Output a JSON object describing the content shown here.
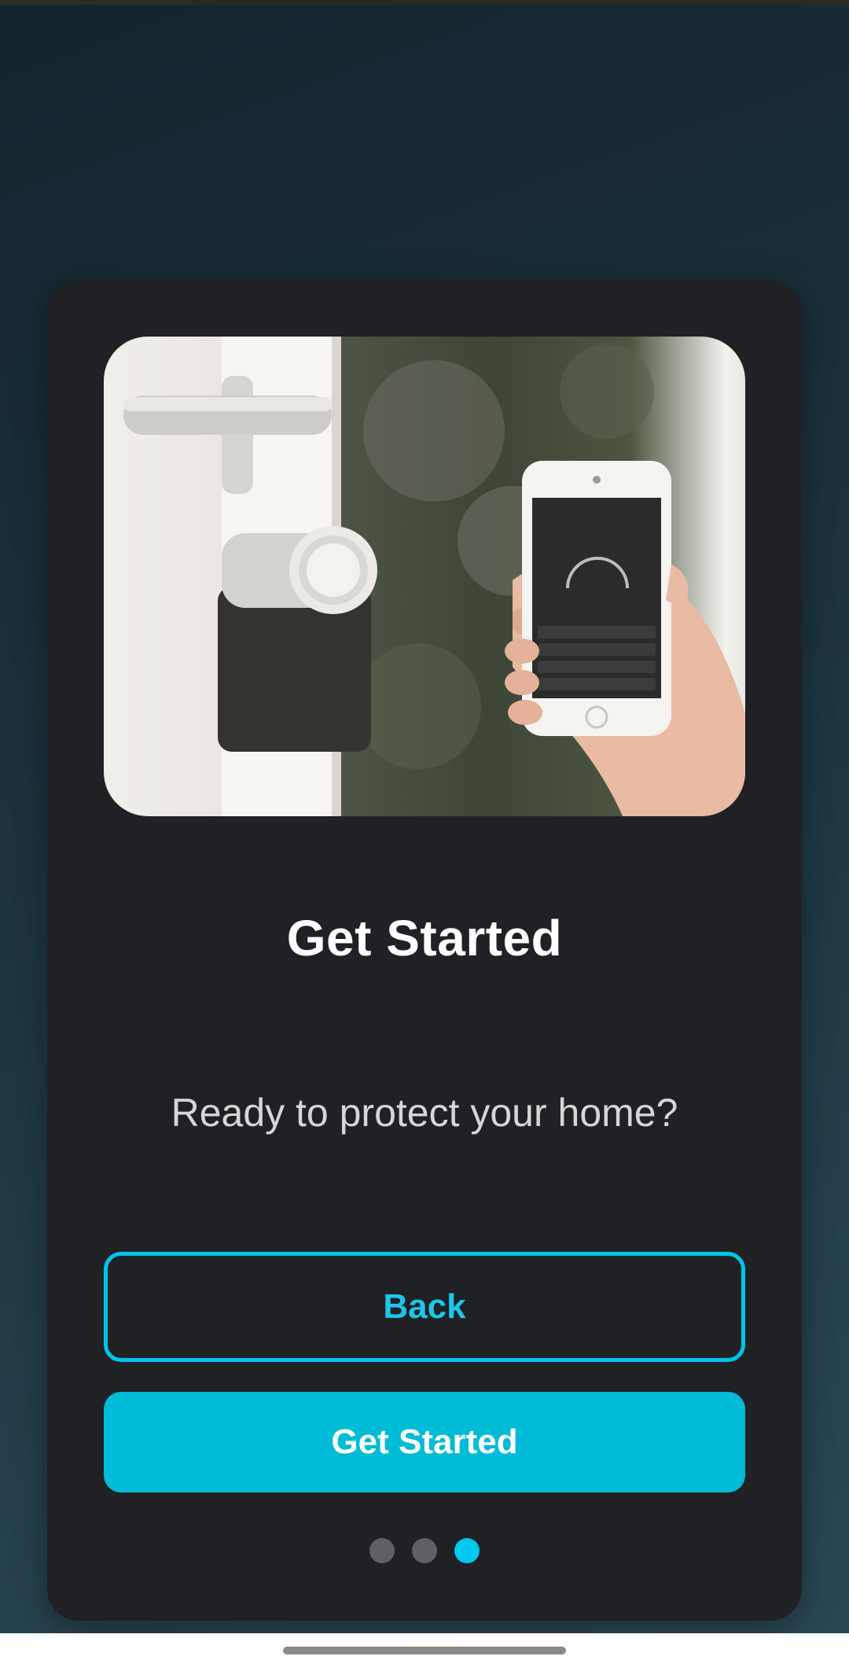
{
  "onboarding": {
    "hero_image": "smart-lock-door-with-phone-app",
    "title": "Get Started",
    "subtitle": "Ready to protect your home?",
    "back_label": "Back",
    "primary_label": "Get Started",
    "pager": {
      "count": 3,
      "active_index": 2
    }
  },
  "colors": {
    "accent": "#00bcd6",
    "card": "#1f2125",
    "dot_inactive": "#5f6064",
    "dot_active": "#00c8f0"
  }
}
